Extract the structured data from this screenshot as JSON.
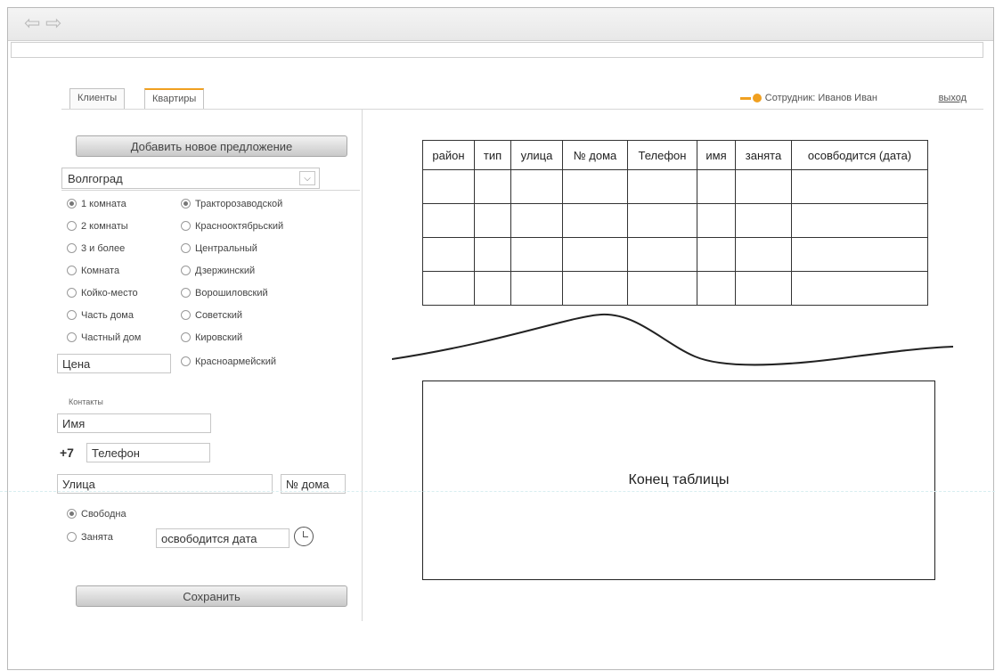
{
  "tabs": [
    {
      "label": "Клиенты",
      "active": false
    },
    {
      "label": "Квартиры",
      "active": true
    }
  ],
  "header": {
    "employee": "Сотрудник: Иванов Иван",
    "logout": "выход",
    "accent_color": "#f0a020"
  },
  "left": {
    "add_button": "Добавить новое предложение",
    "city": "Волгоград",
    "rooms": [
      {
        "label": "1 комната",
        "checked": true
      },
      {
        "label": "2 комнаты",
        "checked": false
      },
      {
        "label": "3 и более",
        "checked": false
      },
      {
        "label": "Комната",
        "checked": false
      },
      {
        "label": "Койко-место",
        "checked": false
      },
      {
        "label": "Часть дома",
        "checked": false
      },
      {
        "label": "Частный дом",
        "checked": false
      }
    ],
    "districts": [
      {
        "label": "Тракторозаводской",
        "checked": true
      },
      {
        "label": "Краснооктябрьский",
        "checked": false
      },
      {
        "label": "Центральный",
        "checked": false
      },
      {
        "label": "Дзержинский",
        "checked": false
      },
      {
        "label": "Ворошиловский",
        "checked": false
      },
      {
        "label": "Советский",
        "checked": false
      },
      {
        "label": "Кировский",
        "checked": false
      },
      {
        "label": "Красноармейский",
        "checked": false
      }
    ],
    "price_placeholder": "Цена",
    "contacts_label": "Контакты",
    "name_placeholder": "Имя",
    "phone_prefix": "+7",
    "phone_placeholder": "Телефон",
    "street_placeholder": "Улица",
    "house_placeholder": "№ дома",
    "status": [
      {
        "label": "Свободна",
        "checked": true
      },
      {
        "label": "Занята",
        "checked": false
      }
    ],
    "release_date_placeholder": "освободится дата",
    "save_button": "Сохранить"
  },
  "table": {
    "headers": [
      "район",
      "тип",
      "улица",
      "№ дома",
      "Телефон",
      "имя",
      "занята",
      "осовбодится (дата)"
    ],
    "empty_rows": 4
  },
  "end_label": "Конец таблицы"
}
